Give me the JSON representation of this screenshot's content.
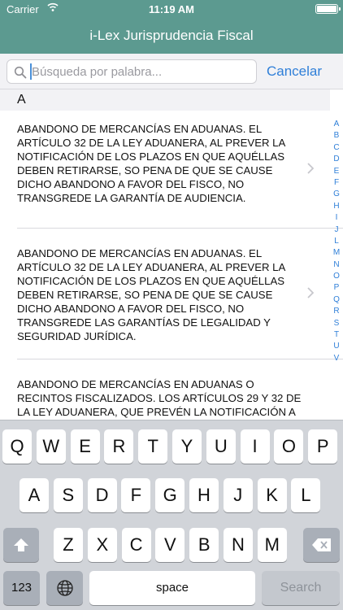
{
  "status_bar": {
    "carrier": "Carrier",
    "time": "11:19 AM"
  },
  "nav": {
    "title": "i-Lex Jurisprudencia Fiscal"
  },
  "search": {
    "placeholder": "Búsqueda por palabra...",
    "cancel_label": "Cancelar"
  },
  "section": {
    "header": "A"
  },
  "list": {
    "items": [
      {
        "text": "ABANDONO DE MERCANCÍAS EN ADUANAS. EL ARTÍCULO 32 DE LA LEY ADUANERA, AL PREVER LA NOTIFICACIÓN DE LOS PLAZOS EN QUE AQUÉLLAS DEBEN RETIRARSE, SO PENA DE QUE SE CAUSE DICHO ABANDONO A FAVOR DEL FISCO, NO TRANSGREDE LA GARANTÍA DE AUDIENCIA."
      },
      {
        "text": "ABANDONO DE MERCANCÍAS EN ADUANAS. EL ARTÍCULO 32 DE LA LEY ADUANERA, AL PREVER LA NOTIFICACIÓN DE LOS PLAZOS EN QUE AQUÉLLAS DEBEN RETIRARSE, SO PENA DE QUE SE CAUSE DICHO ABANDONO A FAVOR DEL FISCO, NO TRANSGREDE LAS GARANTÍAS DE LEGALIDAD Y SEGURIDAD JURÍDICA."
      },
      {
        "text": "ABANDONO DE MERCANCÍAS EN ADUANAS O RECINTOS FISCALIZADOS. LOS ARTÍCULOS 29 Y 32 DE LA LEY ADUANERA, QUE PREVÉN LA NOTIFICACIÓN A LOS PROPIETARIOS O"
      }
    ]
  },
  "index_letters": [
    "A",
    "B",
    "C",
    "D",
    "E",
    "F",
    "G",
    "H",
    "I",
    "J",
    "L",
    "M",
    "N",
    "O",
    "P",
    "Q",
    "R",
    "S",
    "T",
    "U",
    "V"
  ],
  "keyboard": {
    "row1": [
      "Q",
      "W",
      "E",
      "R",
      "T",
      "Y",
      "U",
      "I",
      "O",
      "P"
    ],
    "row2": [
      "A",
      "S",
      "D",
      "F",
      "G",
      "H",
      "J",
      "K",
      "L"
    ],
    "row3": [
      "Z",
      "X",
      "C",
      "V",
      "B",
      "N",
      "M"
    ],
    "numbers_label": "123",
    "space_label": "space",
    "search_label": "Search"
  },
  "colors": {
    "nav_bar": "#5c9a90",
    "accent": "#2f7fd8",
    "keyboard_bg": "#d1d4d9"
  },
  "icons": [
    "wifi-icon",
    "battery-icon",
    "search-icon",
    "chevron-right-icon",
    "shift-icon",
    "backspace-icon",
    "globe-icon"
  ]
}
